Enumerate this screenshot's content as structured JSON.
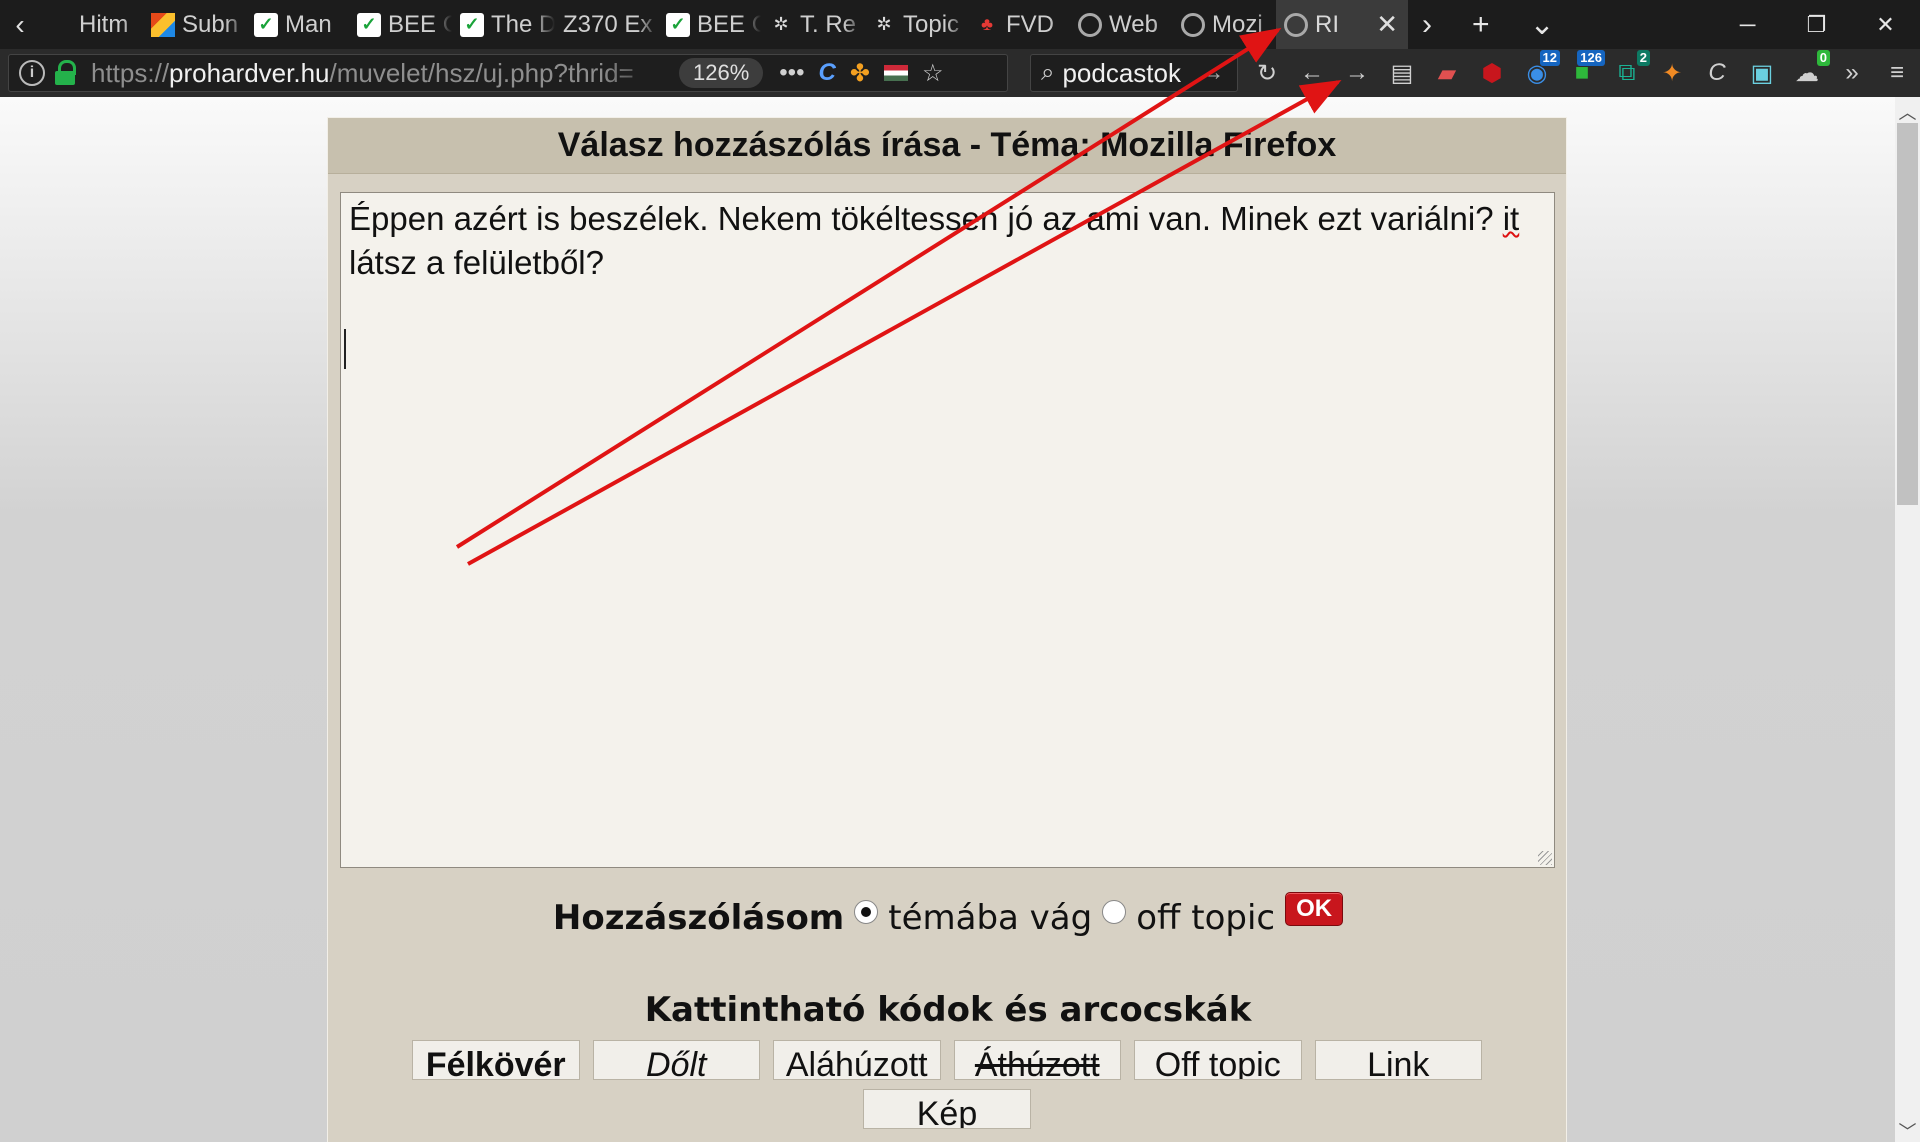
{
  "tabs": [
    {
      "title": "Hitm",
      "favicon": "page-icon"
    },
    {
      "title": "Subn",
      "favicon": "multicolor-icon"
    },
    {
      "title": "Man",
      "favicon": "check-icon"
    },
    {
      "title": "BEE C",
      "favicon": "check-icon"
    },
    {
      "title": "The D",
      "favicon": "check-icon"
    },
    {
      "title": "Z370 Ex",
      "favicon": "none"
    },
    {
      "title": "BEE C",
      "favicon": "check-icon"
    },
    {
      "title": "T. Re",
      "favicon": "dots-icon"
    },
    {
      "title": "Topic",
      "favicon": "dots-icon"
    },
    {
      "title": "FVD",
      "favicon": "tree-icon"
    },
    {
      "title": "Web",
      "favicon": "ring-icon"
    },
    {
      "title": "Mozi",
      "favicon": "ring-icon"
    },
    {
      "title": "RI",
      "favicon": "ring-icon",
      "active": true
    }
  ],
  "tab_tools": {
    "scroll_right": "›",
    "new_tab": "+",
    "list_tabs": "⌄"
  },
  "window_controls": {
    "minimize": "─",
    "restore": "❐",
    "close": "✕"
  },
  "urlbar": {
    "scheme": "https://",
    "host": "prohardver.hu",
    "path": "/muvelet/hsz/uj.php?thrid=",
    "zoom": "126%",
    "more": "•••"
  },
  "search": {
    "query": "podcastok"
  },
  "toolbar_badges": {
    "ext_a": "12",
    "ext_b": "126",
    "ext_c": "2",
    "ext_d": "0"
  },
  "page": {
    "header": "Válasz hozzászólás írása - Téma: Mozilla Firefox",
    "editor_text_line1": "Éppen azért is beszélek. Nekem tökéltessen jó az ami van. Minek ezt variálni? ",
    "editor_misspelled": "it",
    "editor_text_line2": "látsz a felületből?",
    "post_mode_label": "Hozzászólásom",
    "mode_on_topic": "témába vág",
    "mode_off_topic": "off topic",
    "ok_button": "OK",
    "codes_title": "Kattintható kódok és arcocskák",
    "code_buttons": [
      "Félkövér",
      "Dőlt",
      "Aláhúzott",
      "Áthúzott",
      "Off topic",
      "Link",
      "Kép"
    ]
  },
  "colors": {
    "annotation_arrow": "#e01414",
    "ok_red": "#c8161d",
    "panel_bg": "#d7d1c4"
  }
}
